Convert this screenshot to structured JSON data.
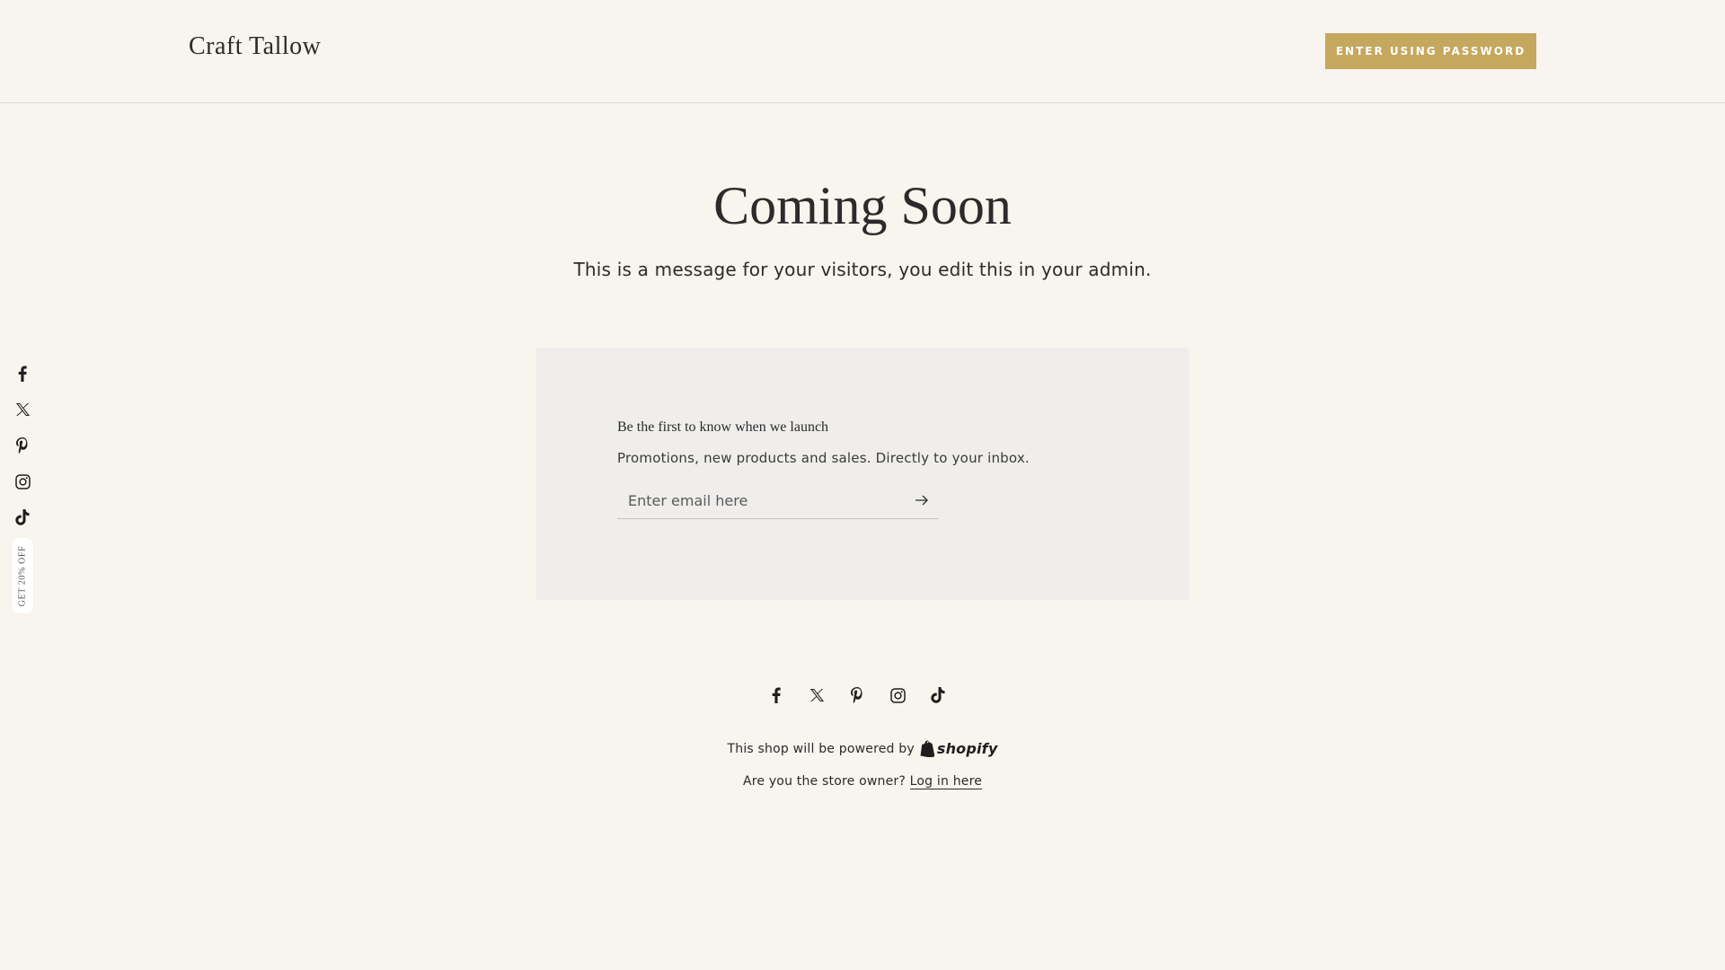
{
  "header": {
    "brand": "Craft Tallow",
    "enter_password_label": "ENTER USING PASSWORD"
  },
  "hero": {
    "title": "Coming Soon",
    "message": "This is a message for your visitors, you edit this in your admin."
  },
  "newsletter": {
    "heading": "Be the first to know when we launch",
    "subheading": "Promotions, new products and sales. Directly to your inbox.",
    "email_placeholder": "Enter email here",
    "submit_icon": "arrow-right-icon"
  },
  "side_social": [
    "facebook-icon",
    "x-icon",
    "pinterest-icon",
    "instagram-icon",
    "tiktok-icon"
  ],
  "promo_tab": {
    "label": "GET 20% OFF"
  },
  "footer_social": [
    "facebook-icon",
    "x-icon",
    "pinterest-icon",
    "instagram-icon",
    "tiktok-icon"
  ],
  "footer": {
    "powered_by": "This shop will be powered by",
    "shopify_word": "shopify",
    "owner_prompt": "Are you the store owner?",
    "login_link": "Log in here"
  },
  "colors": {
    "background": "#f8f4ee",
    "accent": "#c5a85e",
    "card": "#efeeec"
  }
}
